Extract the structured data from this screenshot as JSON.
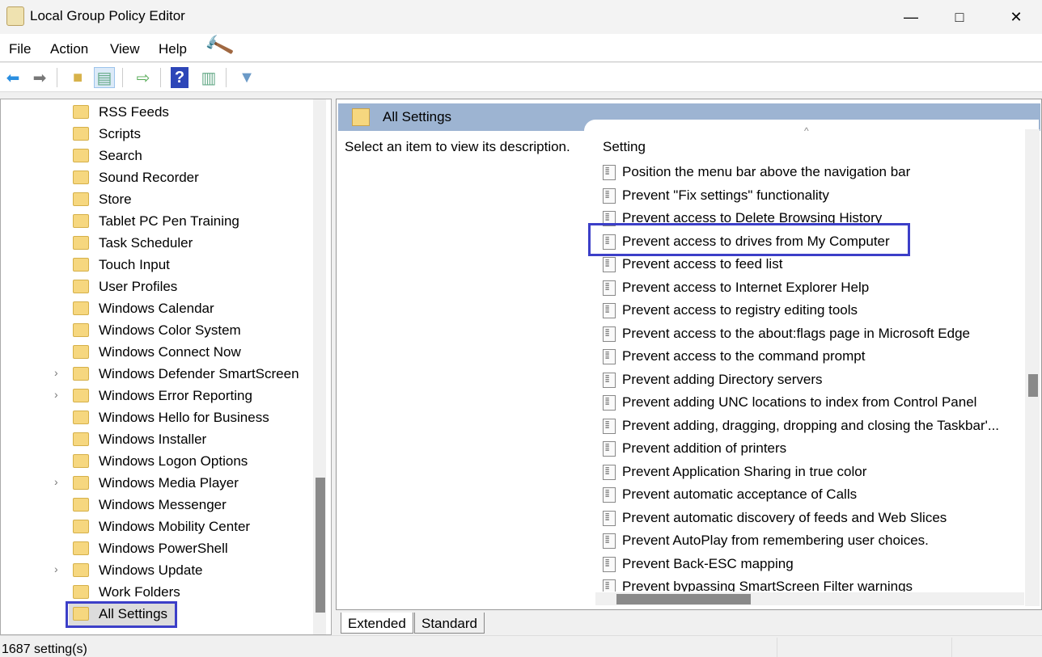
{
  "window": {
    "title": "Local Group Policy Editor",
    "controls": [
      "minimize",
      "maximize",
      "close"
    ]
  },
  "menu": [
    "File",
    "Action",
    "View",
    "Help"
  ],
  "toolbar": [
    "back-icon",
    "forward-icon",
    "up-folder-icon",
    "show-hide-tree-icon",
    "export-list-icon",
    "help-icon",
    "show-action-pane-icon",
    "filter-icon"
  ],
  "tree": [
    {
      "label": "RSS Feeds",
      "expandable": false
    },
    {
      "label": "Scripts",
      "expandable": false
    },
    {
      "label": "Search",
      "expandable": false
    },
    {
      "label": "Sound Recorder",
      "expandable": false
    },
    {
      "label": "Store",
      "expandable": false
    },
    {
      "label": "Tablet PC Pen Training",
      "expandable": false
    },
    {
      "label": "Task Scheduler",
      "expandable": false
    },
    {
      "label": "Touch Input",
      "expandable": false
    },
    {
      "label": "User Profiles",
      "expandable": false
    },
    {
      "label": "Windows Calendar",
      "expandable": false
    },
    {
      "label": "Windows Color System",
      "expandable": false
    },
    {
      "label": "Windows Connect Now",
      "expandable": false
    },
    {
      "label": "Windows Defender SmartScreen",
      "expandable": true
    },
    {
      "label": "Windows Error Reporting",
      "expandable": true
    },
    {
      "label": "Windows Hello for Business",
      "expandable": false
    },
    {
      "label": "Windows Installer",
      "expandable": false
    },
    {
      "label": "Windows Logon Options",
      "expandable": false
    },
    {
      "label": "Windows Media Player",
      "expandable": true
    },
    {
      "label": "Windows Messenger",
      "expandable": false
    },
    {
      "label": "Windows Mobility Center",
      "expandable": false
    },
    {
      "label": "Windows PowerShell",
      "expandable": false
    },
    {
      "label": "Windows Update",
      "expandable": true
    },
    {
      "label": "Work Folders",
      "expandable": false
    },
    {
      "label": "All Settings",
      "expandable": false,
      "selected": true
    }
  ],
  "main": {
    "header": "All Settings",
    "description": "Select an item to view its description.",
    "column": "Setting",
    "settings": [
      "Position the menu bar above the navigation bar",
      "Prevent \"Fix settings\" functionality",
      "Prevent access to Delete Browsing History",
      "Prevent access to drives from My Computer",
      "Prevent access to feed list",
      "Prevent access to Internet Explorer Help",
      "Prevent access to registry editing tools",
      "Prevent access to the about:flags page in Microsoft Edge",
      "Prevent access to the command prompt",
      "Prevent adding Directory servers",
      "Prevent adding UNC locations to index from Control Panel",
      "Prevent adding, dragging, dropping and closing the Taskbar'...",
      "Prevent addition of printers",
      "Prevent Application Sharing in true color",
      "Prevent automatic acceptance of Calls",
      "Prevent automatic discovery of feeds and Web Slices",
      "Prevent AutoPlay from remembering user choices.",
      "Prevent Back-ESC mapping",
      "Prevent bypassing SmartScreen Filter warnings"
    ],
    "highlighted": "Prevent access to drives from My Computer",
    "tabs": [
      "Extended",
      "Standard"
    ],
    "active_tab": "Extended"
  },
  "status": "1687 setting(s)",
  "colors": {
    "header": "#9db4d2",
    "highlight_box": "#3c3fc8"
  }
}
